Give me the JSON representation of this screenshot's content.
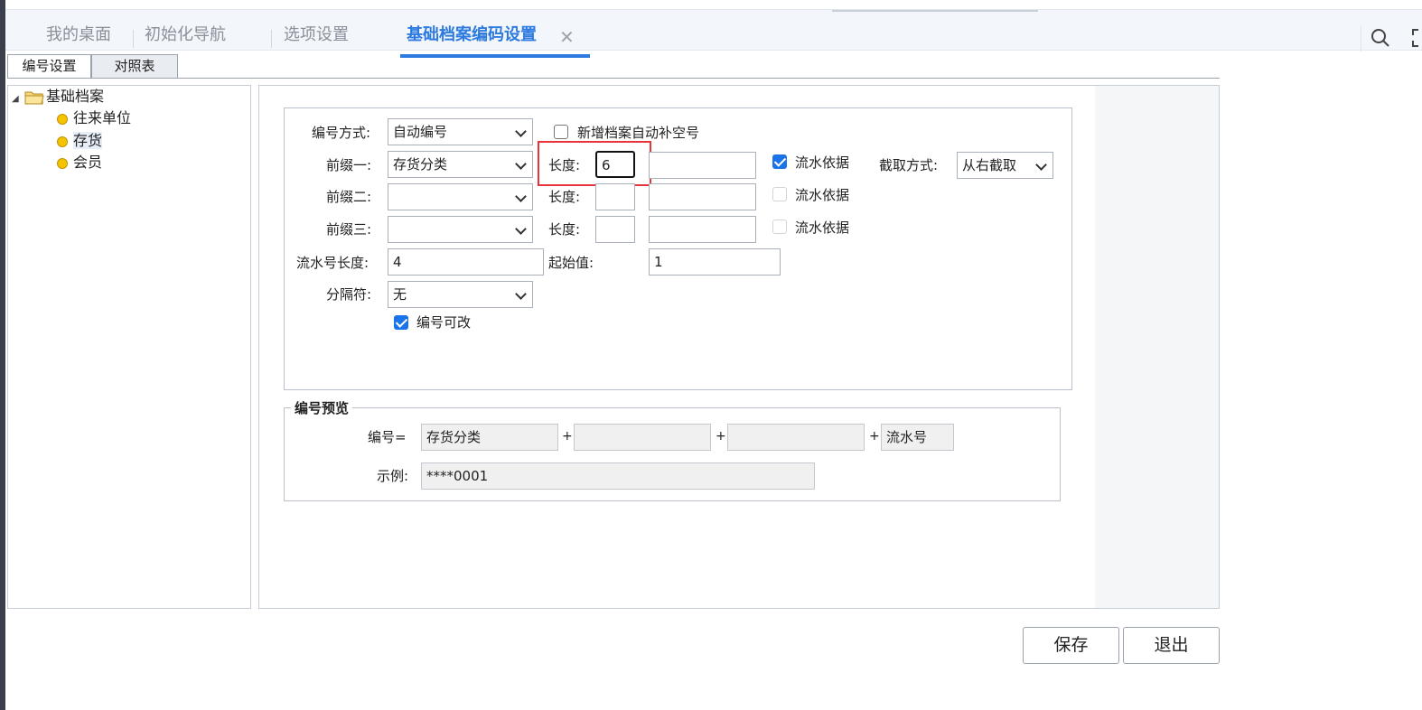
{
  "tabs": [
    {
      "label": "我的桌面"
    },
    {
      "label": "初始化导航"
    },
    {
      "label": "选项设置"
    },
    {
      "label": "基础档案编码设置"
    }
  ],
  "close_glyph": "✕",
  "subtabs": [
    {
      "label": "编号设置"
    },
    {
      "label": "对照表"
    }
  ],
  "tree": {
    "root": "基础档案",
    "children": [
      {
        "label": "往来单位"
      },
      {
        "label": "存货"
      },
      {
        "label": "会员"
      }
    ]
  },
  "form": {
    "mode_label": "编号方式:",
    "mode_value": "自动编号",
    "autofill_label": "新增档案自动补空号",
    "autofill_checked": false,
    "prefix1_label": "前缀一:",
    "prefix1_value": "存货分类",
    "prefix2_label": "前缀二:",
    "prefix2_value": "",
    "prefix3_label": "前缀三:",
    "prefix3_value": "",
    "length_label": "长度:",
    "len1": "6",
    "len2": "",
    "len3": "",
    "flow_basis_label": "流水依据",
    "flow_basis_checked": [
      true,
      false,
      false
    ],
    "cut_label": "截取方式:",
    "cut_value": "从右截取",
    "serial_len_label": "流水号长度:",
    "serial_len_value": "4",
    "start_label": "起始值:",
    "start_value": "1",
    "sep_label": "分隔符:",
    "sep_value": "无",
    "editable_label": "编号可改",
    "editable_checked": true
  },
  "preview": {
    "legend": "编号预览",
    "code_label": "编号=",
    "parts": [
      "存货分类",
      "",
      "",
      "流水号"
    ],
    "plus": "+",
    "example_label": "示例:",
    "example_value": "****0001"
  },
  "buttons": {
    "save": "保存",
    "exit": "退出"
  },
  "colors": {
    "accent": "#2d7be0",
    "highlight": "#e8333a",
    "checkbox": "#1a73e8"
  }
}
